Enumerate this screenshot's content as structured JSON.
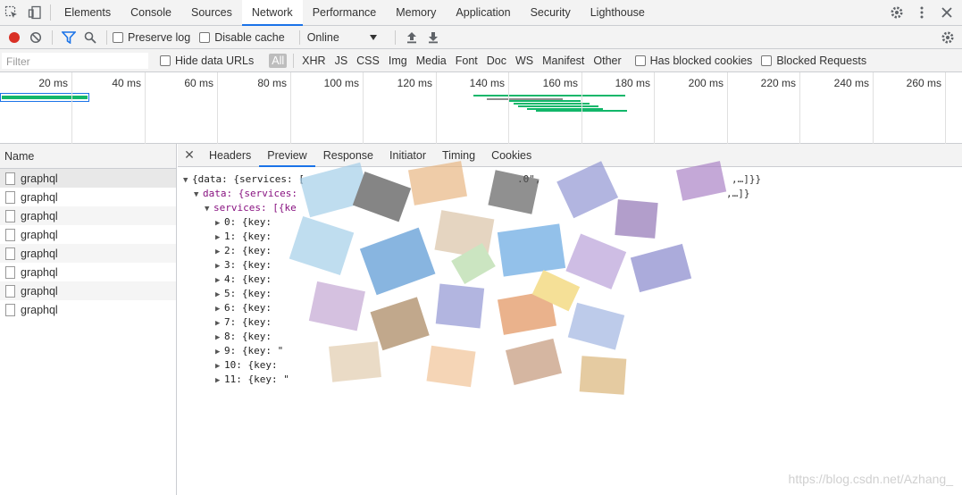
{
  "toptabs": {
    "items": [
      "Elements",
      "Console",
      "Sources",
      "Network",
      "Performance",
      "Memory",
      "Application",
      "Security",
      "Lighthouse"
    ],
    "active": "Network"
  },
  "toolbar": {
    "preserve_log": "Preserve log",
    "disable_cache": "Disable cache",
    "throttling": "Online"
  },
  "filterbar": {
    "placeholder": "Filter",
    "hide_data_urls": "Hide data URLs",
    "types": [
      "All",
      "XHR",
      "JS",
      "CSS",
      "Img",
      "Media",
      "Font",
      "Doc",
      "WS",
      "Manifest",
      "Other"
    ],
    "has_blocked_cookies": "Has blocked cookies",
    "blocked_requests": "Blocked Requests"
  },
  "timeline": {
    "ticks": [
      "20 ms",
      "40 ms",
      "60 ms",
      "80 ms",
      "100 ms",
      "120 ms",
      "140 ms",
      "160 ms",
      "180 ms",
      "200 ms",
      "220 ms",
      "240 ms",
      "260 ms"
    ]
  },
  "requests": {
    "header": "Name",
    "items": [
      "graphql",
      "graphql",
      "graphql",
      "graphql",
      "graphql",
      "graphql",
      "graphql",
      "graphql"
    ]
  },
  "details": {
    "tabs": [
      "Headers",
      "Preview",
      "Response",
      "Initiator",
      "Timing",
      "Cookies"
    ],
    "active": "Preview",
    "lines": [
      "{data: {services: [",
      "data: {services:",
      "services: [{ke",
      "0: {key: ",
      "1: {key: ",
      "2: {key: ",
      "3: {key: ",
      "4: {key: ",
      "5: {key: ",
      "6: {key: ",
      "7: {key: ",
      "8: {key: ",
      "9: {key: \"",
      "10: {key: ",
      "11: {key: \""
    ],
    "line_ends": [
      ".0\",",
      ",…]}}",
      ",…]}"
    ]
  },
  "watermark": "https://blog.csdn.net/Azhang_"
}
